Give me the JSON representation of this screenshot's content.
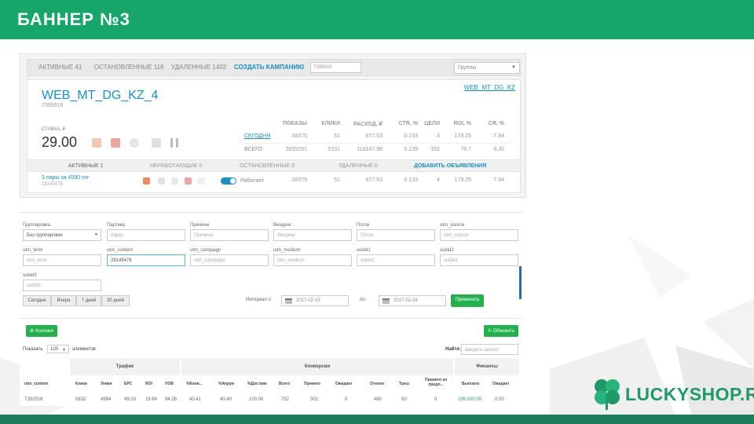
{
  "slide": {
    "title": "БАННЕР №3"
  },
  "logo": {
    "text": "LUCKYSHOP.RU"
  },
  "colors": {
    "brand_green": "#17a66a",
    "link_blue": "#1a8fc4",
    "button_green": "#22b14c"
  },
  "campaign_tabs": {
    "active": "АКТИВНЫЕ 41",
    "stopped": "ОСТАНОВЛЕННЫЕ 118",
    "deleted": "УДАЛЕННЫЕ 1402",
    "create": "СОЗДАТЬ КАМПАНИЮ",
    "search_value": "7395919",
    "groups_select": "Группы"
  },
  "campaign": {
    "name": "WEB_MT_DG_KZ_4",
    "id": "7395919",
    "link": "WEB_MT_DG_KZ",
    "bid_label": "СТАВКА, ₽",
    "bid_value": "29.00",
    "stats_headers": [
      "ПОКАЗЫ",
      "КЛИКИ",
      "РАСХОД, ₽",
      "CTR, %",
      "ЦЕЛИ",
      "ROI, %",
      "CR, %"
    ],
    "today_label": "СЕГОДНЯ",
    "total_label": "ВСЕГО",
    "today_values": [
      "38375",
      "51",
      "877.53",
      "0.133",
      "4",
      "179.25",
      "7.84"
    ],
    "total_values": [
      "3835291",
      "5331",
      "118147.98",
      "0.139",
      "332",
      "79.7",
      "8.30"
    ]
  },
  "ad_tabs": {
    "active": "АКТИВНЫЕ 1",
    "not_working": "НЕРАБОТАЮЩИЕ 0",
    "stopped": "ОСТАНОВЛЕННЫЕ 0",
    "deleted": "УДАЛЕННЫЕ 0",
    "add": "ДОБАВИТЬ ОБЪЯВЛЕНИЯ"
  },
  "ad": {
    "title": "3 пары за 4590 тнг",
    "id": "28145478",
    "status": "Работает",
    "values": [
      "38375",
      "51",
      "877.53",
      "0.133",
      "4",
      "179.25",
      "7.84"
    ]
  },
  "filters": {
    "grouping_label": "Группировка",
    "grouping_value": "Без группировки",
    "partner_label": "Партнер",
    "partner_placeholder": "Афир",
    "reason_label": "Причина",
    "reason_placeholder": "Причина",
    "landing_label": "Вендинг",
    "landing_placeholder": "Лендинг",
    "stream_label": "Поток",
    "stream_placeholder": "Поток",
    "utm_source_label": "utm_source",
    "utm_source_placeholder": "utm_source",
    "utm_term_label": "utm_term",
    "utm_term_placeholder": "utm_term",
    "utm_content_label": "utm_content",
    "utm_content_value": "28145478",
    "utm_campaign_label": "utm_campaign",
    "utm_campaign_placeholder": "utm_campaign",
    "utm_medium_label": "utm_medium",
    "utm_medium_placeholder": "utm_medium",
    "subid1_label": "subid1",
    "subid1_placeholder": "subid1",
    "subid2_label": "subid2",
    "subid2_placeholder": "subid2",
    "subid3_label": "subid3",
    "subid3_placeholder": "subid3",
    "quick": [
      "Сегодня",
      "Вчера",
      "7 дней",
      "30 дней"
    ],
    "interval_label": "Интервал с:",
    "date_from": "2017-02-15",
    "to_label": "по:",
    "date_to": "2017-02-28",
    "apply": "Применить"
  },
  "table": {
    "columns_button": "Колонки",
    "refresh_button": "Обновить",
    "show_label": "Показать",
    "page_size": "100",
    "entries_label": "элементов",
    "search_label": "Найти:",
    "search_placeholder": "введите запрос",
    "groups": [
      "Трафик",
      "Конверсии",
      "Финансы"
    ],
    "headers": [
      "utm_content",
      "Клики",
      "Уники",
      "EPC",
      "ROI",
      "VOB",
      "%Конв...",
      "%Апрув",
      "%Доставк",
      "Всего",
      "Принято",
      "Ожидает",
      "Отклон",
      "Треш",
      "Принято из предл...",
      "Выплата",
      "Ожидает"
    ],
    "row": [
      "7392518",
      "5632",
      "4994",
      "49.03",
      "19.84",
      "94.28",
      "40.41",
      "40.40",
      "100.00",
      "752",
      "302",
      "0",
      "480",
      "50",
      "0",
      "199 200.00",
      "0.00"
    ]
  }
}
